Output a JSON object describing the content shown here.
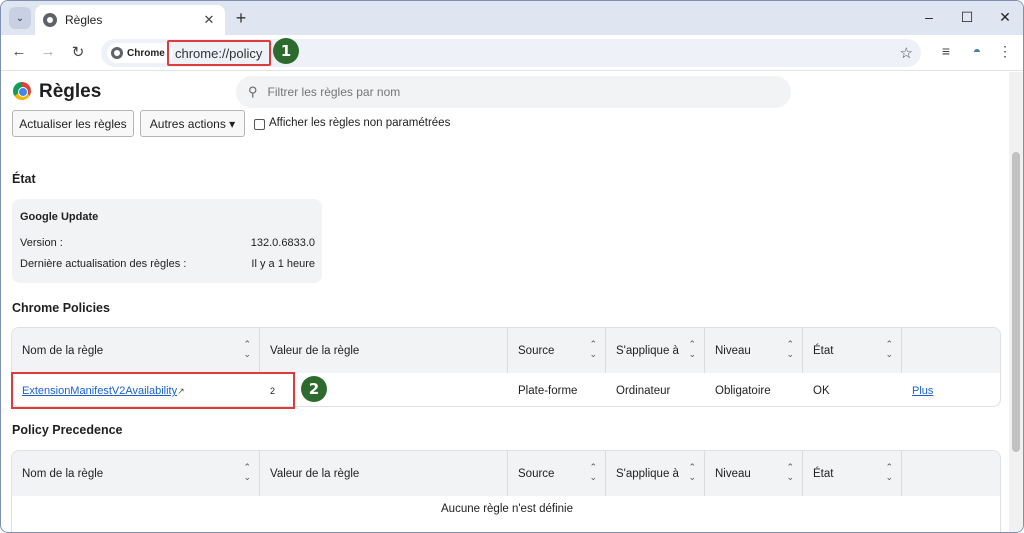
{
  "browser": {
    "tab_title": "Règles",
    "url_chip": "Chrome",
    "url": "chrome://policy",
    "tab_search_glyph": "⌄",
    "new_tab_glyph": "+",
    "tab_close_glyph": "✕",
    "window_controls": [
      "–",
      "☐",
      "✕"
    ],
    "nav": {
      "back": "←",
      "forward": "→",
      "reload": "↻"
    },
    "bookmark_glyph": "☆",
    "toolbar_icons": [
      "≡",
      "◓",
      "⋮"
    ]
  },
  "annotations": {
    "badge_1": "1",
    "badge_2": "2"
  },
  "page": {
    "title": "Règles",
    "filter_placeholder": "Filtrer les règles par nom",
    "search_glyph": "⚲",
    "reload_button": "Actualiser les règles",
    "more_actions_button": "Autres actions",
    "dropdown_glyph": "▾",
    "show_unset_label": "Afficher les règles non paramétrées",
    "status_heading": "État",
    "status_card": {
      "title": "Google Update",
      "rows": [
        {
          "label": "Version :",
          "value": "132.0.6833.0"
        },
        {
          "label": "Dernière actualisation des règles :",
          "value": "Il y a 1 heure"
        }
      ]
    },
    "chrome_policies_heading": "Chrome Policies",
    "policy_precedence_heading": "Policy Precedence",
    "columns": [
      "Nom de la règle",
      "Valeur de la règle",
      "Source",
      "S'applique à",
      "Niveau",
      "État"
    ],
    "sort_glyphs": {
      "up": "⌃",
      "down": "⌄"
    },
    "policies": [
      {
        "name": "ExtensionManifestV2Availability",
        "external_glyph": "↗",
        "value": "2",
        "source": "Plate-forme",
        "scope": "Ordinateur",
        "level": "Obligatoire",
        "status": "OK",
        "more": "Plus"
      }
    ],
    "precedence_empty": "Aucune règle n'est définie"
  },
  "colors": {
    "annotation_red": "#e03a3a",
    "badge_green": "#2d6a2d",
    "link_blue": "#1a5fd1"
  }
}
